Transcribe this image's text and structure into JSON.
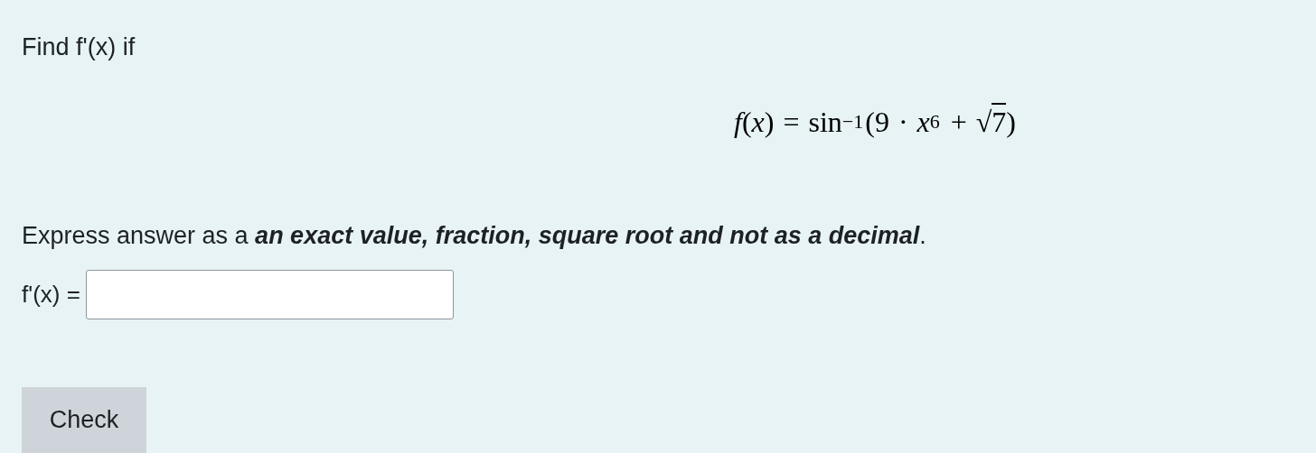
{
  "prompt": "Find f'(x) if",
  "formula": [
    {
      "kind": "var",
      "text": "f"
    },
    {
      "kind": "text",
      "text": "("
    },
    {
      "kind": "var",
      "text": "x"
    },
    {
      "kind": "text",
      "text": ")"
    },
    {
      "kind": "op",
      "text": "="
    },
    {
      "kind": "text",
      "text": "sin"
    },
    {
      "kind": "sup",
      "text": "−1"
    },
    {
      "kind": "text",
      "text": "(9"
    },
    {
      "kind": "op",
      "text": "·"
    },
    {
      "kind": "var",
      "text": "x"
    },
    {
      "kind": "sup",
      "text": "6"
    },
    {
      "kind": "op",
      "text": "+"
    },
    {
      "kind": "sqrt",
      "symbol": "√",
      "text": "7"
    },
    {
      "kind": "text",
      "text": ")"
    }
  ],
  "instruction": [
    {
      "text": "Express answer as a ",
      "emphasis": false
    },
    {
      "text": "an exact value, fraction, square root and not as a decimal",
      "emphasis": true
    },
    {
      "text": ".",
      "emphasis": false
    }
  ],
  "answer": {
    "label": "f'(x) ="
  },
  "buttons": [
    {
      "label": "Check"
    }
  ]
}
